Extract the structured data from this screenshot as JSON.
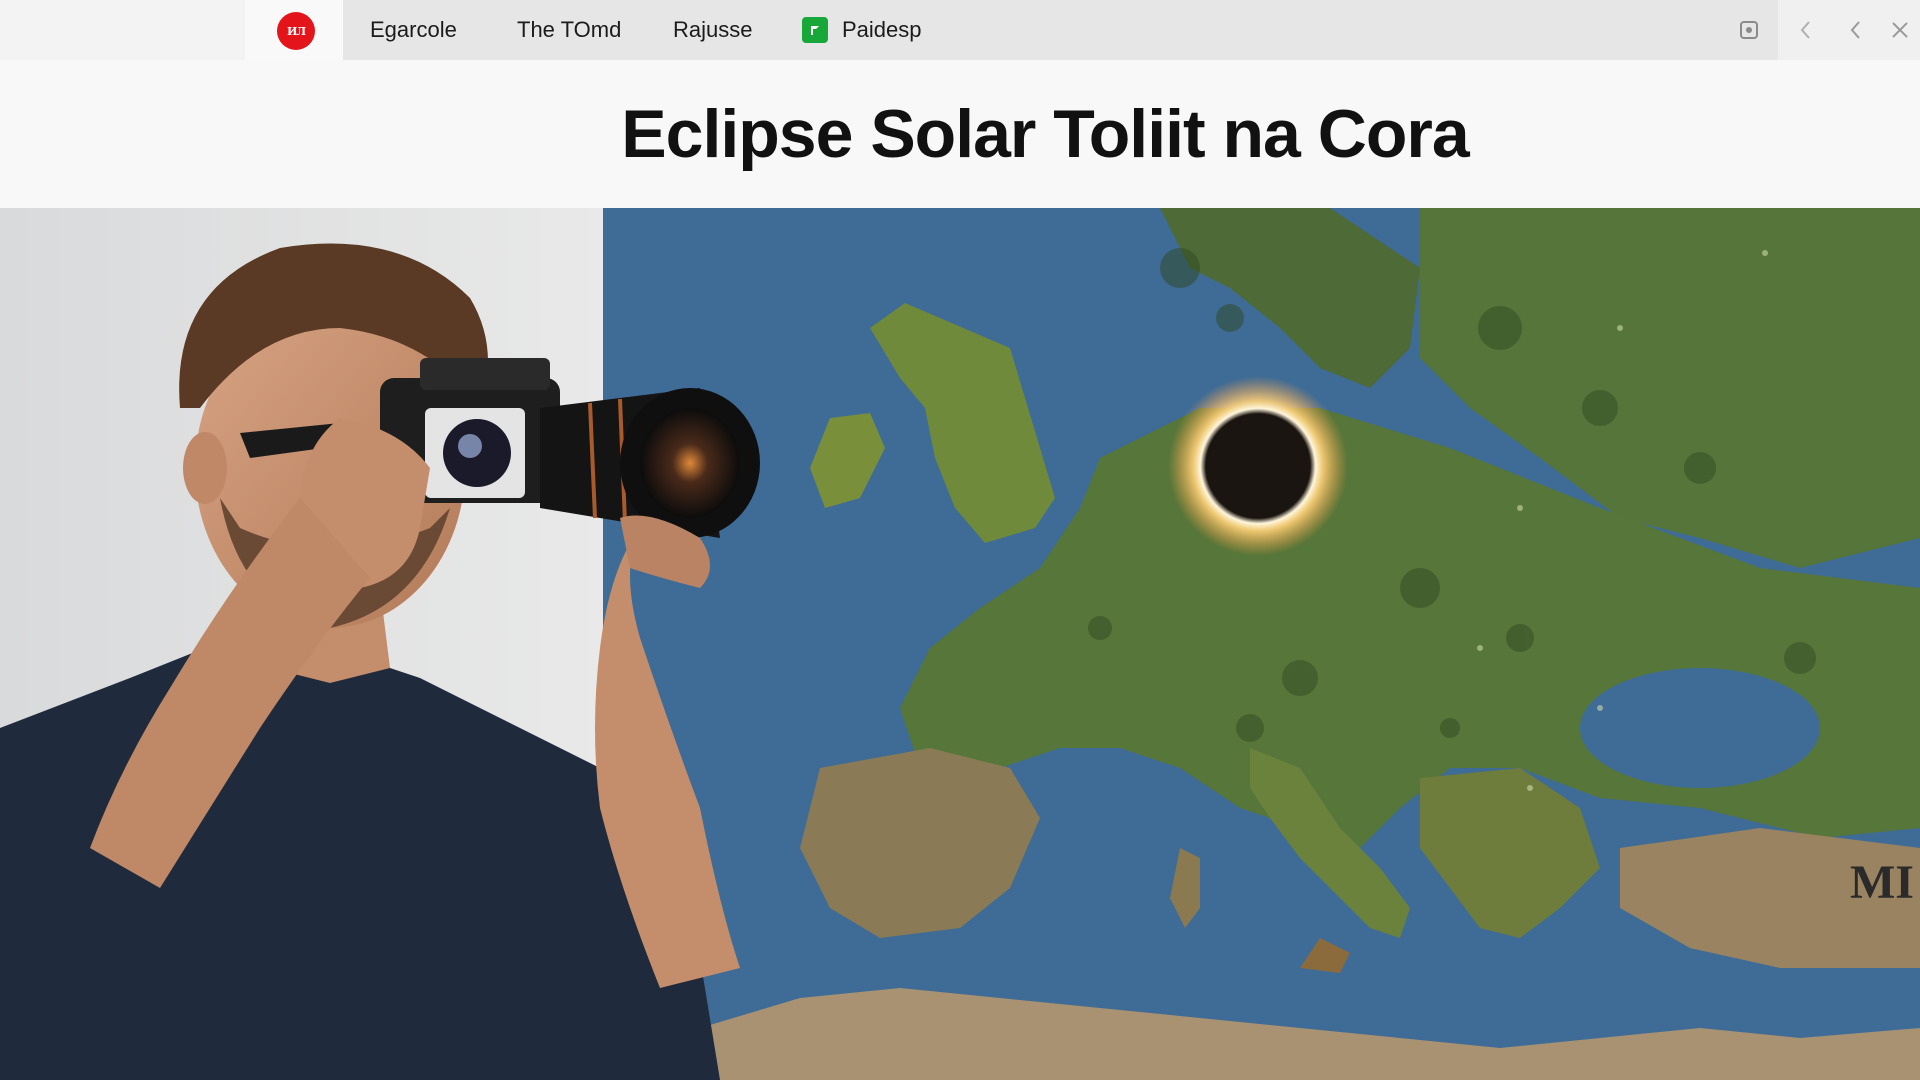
{
  "header": {
    "logo_text": "ИЛ",
    "tabs": [
      {
        "label": "Egarcole"
      },
      {
        "label": "The TOmd"
      },
      {
        "label": "Rajusse"
      },
      {
        "label": "Paidesp"
      }
    ]
  },
  "article": {
    "title": "Eclipse Solar Toliit na Cora"
  },
  "hero": {
    "map_corner_label": "MI"
  },
  "colors": {
    "logo_red": "#e3141a",
    "tab_icon_green": "#18a83a",
    "ocean": "#3e6c96",
    "shirt": "#1f2a3c"
  },
  "icons": {
    "window_square": "square-icon",
    "back": "chevron-left-icon",
    "forward": "chevron-left-icon",
    "close": "close-icon"
  }
}
